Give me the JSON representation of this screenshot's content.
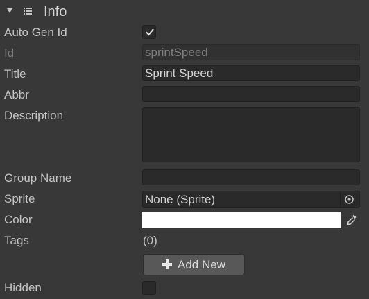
{
  "header": {
    "title": "Info",
    "foldout_icon": "triangle-down-icon",
    "section_icon": "list-icon"
  },
  "fields": {
    "auto_gen_id": {
      "label": "Auto Gen Id",
      "checked": true
    },
    "id": {
      "label": "Id",
      "value": "sprintSpeed"
    },
    "title": {
      "label": "Title",
      "value": "Sprint Speed"
    },
    "abbr": {
      "label": "Abbr",
      "value": ""
    },
    "description": {
      "label": "Description",
      "value": ""
    },
    "group_name": {
      "label": "Group Name",
      "value": ""
    },
    "sprite": {
      "label": "Sprite",
      "value": "None (Sprite)",
      "picker_icon": "object-picker-icon"
    },
    "color": {
      "label": "Color",
      "value": "#ffffff",
      "picker_icon": "eyedropper-icon"
    },
    "tags": {
      "label": "Tags",
      "count": "(0)",
      "add_button": "Add New"
    },
    "hidden": {
      "label": "Hidden",
      "checked": false
    }
  }
}
